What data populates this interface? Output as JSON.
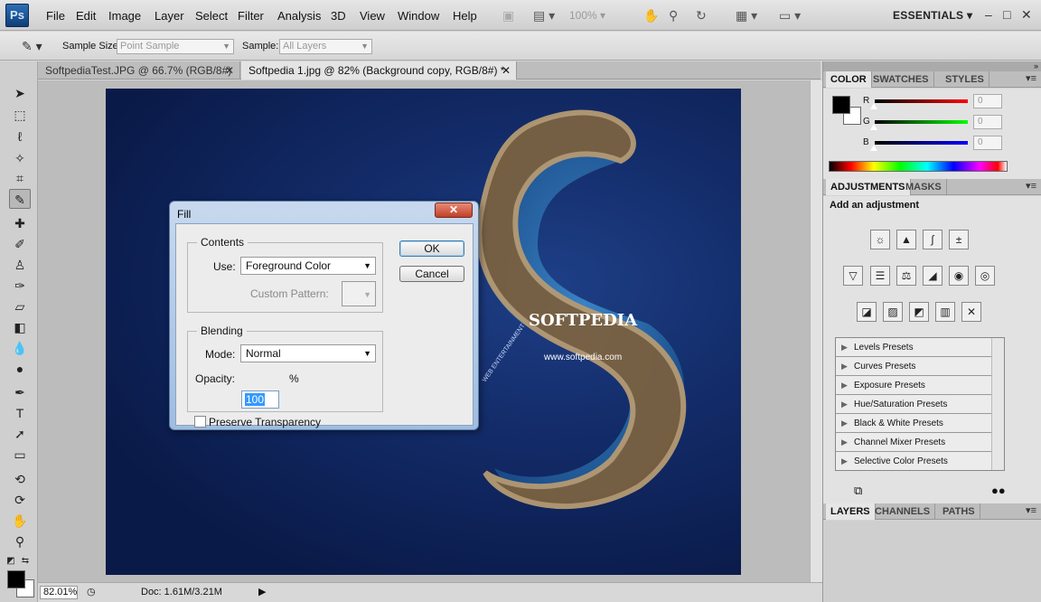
{
  "app": {
    "logo": "Ps",
    "menus": [
      "File",
      "Edit",
      "Image",
      "Layer",
      "Select",
      "Filter",
      "Analysis",
      "3D",
      "View",
      "Window",
      "Help"
    ],
    "zoom_combo": "100%",
    "workspace": "ESSENTIALS",
    "window_controls": {
      "minimize": "–",
      "restore": "□",
      "close": "✕"
    }
  },
  "options_bar": {
    "sample_size_label": "Sample Size:",
    "sample_size_value": "Point Sample",
    "sample_label": "Sample:",
    "sample_value": "All Layers"
  },
  "doc_tabs": [
    {
      "title": "SoftpediaTest.JPG @ 66.7% (RGB/8#)",
      "close": "✕"
    },
    {
      "title": "Softpedia 1.jpg @ 82% (Background copy, RGB/8#) *",
      "close": "✕"
    }
  ],
  "canvas": {
    "brand": "SOFTPEDIA",
    "url": "www.softpedia.com",
    "tagline": "WEB ENTERTAINMENT"
  },
  "status": {
    "zoom": "82.01%",
    "doc_info": "Doc: 1.61M/3.21M"
  },
  "fill_dialog": {
    "title": "Fill",
    "close": "✕",
    "contents_title": "Contents",
    "use_label": "Use:",
    "use_value": "Foreground Color",
    "custom_pattern_label": "Custom Pattern:",
    "blending_title": "Blending",
    "mode_label": "Mode:",
    "mode_value": "Normal",
    "opacity_label": "Opacity:",
    "opacity_value": "100",
    "opacity_unit": "%",
    "preserve_label": "Preserve Transparency",
    "preserve_checked": false,
    "ok": "OK",
    "cancel": "Cancel"
  },
  "color_panel": {
    "tabs": [
      "COLOR",
      "SWATCHES",
      "STYLES"
    ],
    "channels": [
      {
        "label": "R",
        "value": "0",
        "color": "#e00000"
      },
      {
        "label": "G",
        "value": "0",
        "color": "#00c000"
      },
      {
        "label": "B",
        "value": "0",
        "color": "#0000e0"
      }
    ],
    "foreground": "#000000",
    "background": "#ffffff"
  },
  "adjustments_panel": {
    "tabs": [
      "ADJUSTMENTS",
      "MASKS"
    ],
    "heading": "Add an adjustment",
    "presets": [
      "Levels Presets",
      "Curves Presets",
      "Exposure Presets",
      "Hue/Saturation Presets",
      "Black & White Presets",
      "Channel Mixer Presets",
      "Selective Color Presets"
    ]
  },
  "layers_panel": {
    "tabs": [
      "LAYERS",
      "CHANNELS",
      "PATHS"
    ]
  }
}
